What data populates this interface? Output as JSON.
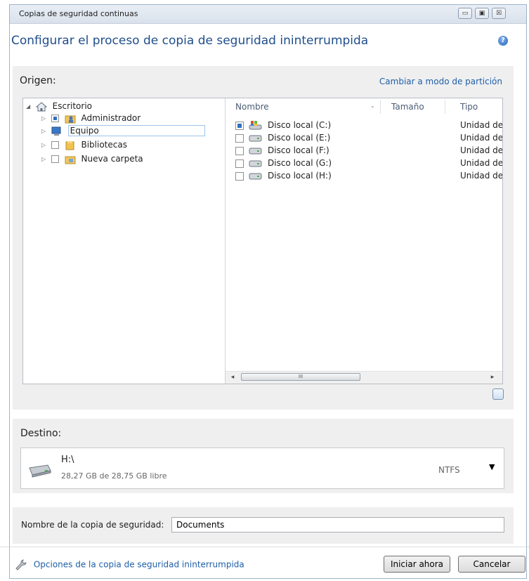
{
  "window": {
    "title": "Copias de seguridad continuas",
    "controls": {
      "minimize": "▭",
      "maximize": "▣",
      "close": "☒"
    }
  },
  "header": {
    "title": "Configurar el proceso de copia de seguridad ininterrumpida",
    "help_icon": "?"
  },
  "origin": {
    "label": "Origen:",
    "switch_link": "Cambiar a modo de partición",
    "tree": [
      {
        "label": "Escritorio",
        "icon": "desktop-icon"
      },
      {
        "label": "Administrador",
        "icon": "user-folder-icon"
      },
      {
        "label": "Equipo",
        "icon": "computer-icon"
      },
      {
        "label": "Bibliotecas",
        "icon": "library-folder-icon"
      },
      {
        "label": "Nueva carpeta",
        "icon": "folder-icon"
      }
    ],
    "columns": {
      "name": "Nombre",
      "size": "Tamaño",
      "type": "Tipo"
    },
    "drives": [
      {
        "name": "Disco local (C:)",
        "type": "Unidad de",
        "checked": "partial"
      },
      {
        "name": "Disco local (E:)",
        "type": "Unidad de",
        "checked": "none"
      },
      {
        "name": "Disco local (F:)",
        "type": "Unidad de",
        "checked": "none"
      },
      {
        "name": "Disco local (G:)",
        "type": "Unidad de",
        "checked": "none"
      },
      {
        "name": "Disco local (H:)",
        "type": "Unidad de",
        "checked": "none"
      }
    ],
    "scroll": {
      "left": "◂",
      "right": "▸",
      "grip": "III"
    }
  },
  "destination": {
    "label": "Destino:",
    "drive": "H:\\",
    "free": "28,27 GB de 28,75 GB libre",
    "fs": "NTFS",
    "arrow": "▼"
  },
  "backup_name": {
    "label": "Nombre de la copia de seguridad:",
    "value": "Documents"
  },
  "footer": {
    "options_link": "Opciones de la copia de seguridad ininterrumpida",
    "start": "Iniciar ahora",
    "cancel": "Cancelar"
  },
  "colors": {
    "accent": "#1f5fa8",
    "title": "#1f4e8c",
    "panel": "#efefef"
  }
}
